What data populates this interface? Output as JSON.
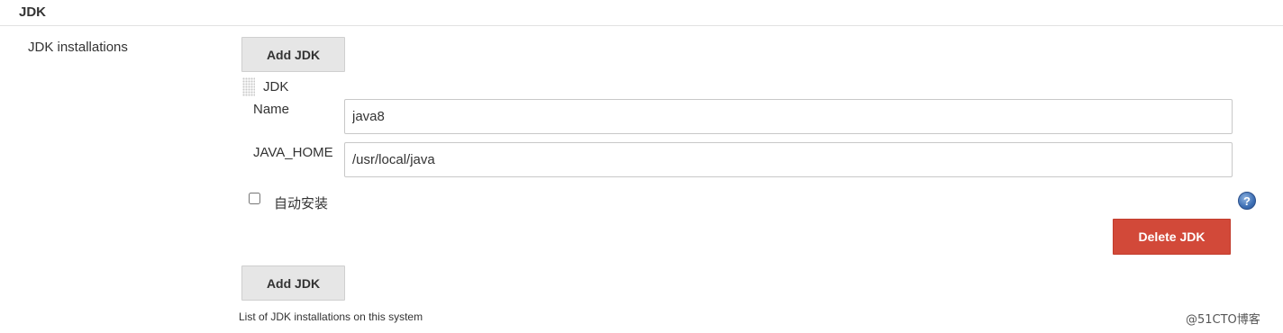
{
  "section": {
    "title": "JDK"
  },
  "jdk_installations": {
    "label": "JDK installations",
    "add_button_label": "Add JDK",
    "description": "List of JDK installations on this system"
  },
  "jdk_entry": {
    "title": "JDK",
    "name_label": "Name",
    "name_value": "java8",
    "java_home_label": "JAVA_HOME",
    "java_home_value": "/usr/local/java",
    "auto_install_label": "自动安装",
    "auto_install_checked": false,
    "help_symbol": "?",
    "delete_button_label": "Delete JDK"
  },
  "watermark": "@51CTO博客",
  "colors": {
    "delete_button": "#d24939",
    "add_button": "#e6e6e6",
    "help_icon": "#3d6fb4"
  },
  "icons": {
    "drag_handle": "drag-handle-icon",
    "help": "help-icon"
  }
}
